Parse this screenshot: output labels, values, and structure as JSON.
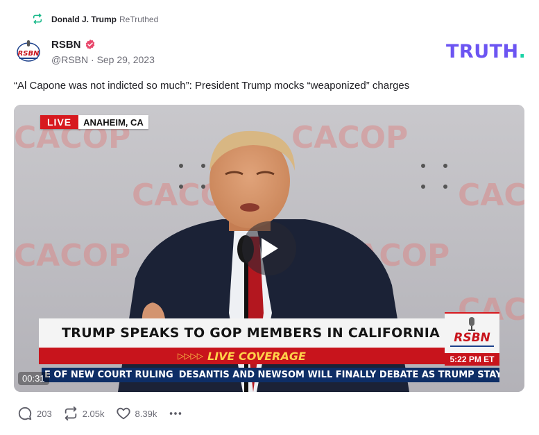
{
  "retruth": {
    "user": "Donald J. Trump",
    "label": "ReTruthed"
  },
  "account": {
    "name": "RSBN",
    "handle": "@RSBN",
    "separator": " · ",
    "date": "Sep 29, 2023",
    "avatar_text": "RSBN"
  },
  "logo": {
    "text": "TRUTH",
    "dot": "."
  },
  "post": {
    "text": "“Al Capone was not indicted so much”: President Trump mocks “weaponized” charges"
  },
  "video": {
    "live_label": "LIVE",
    "location": "ANAHEIM, CA",
    "headline": "TRUMP SPEAKS TO GOP MEMBERS IN CALIFORNIA",
    "coverage_arrows": "▷▷▷▷",
    "coverage": "LIVE COVERAGE",
    "network": "RSBN",
    "clock": "5:22 PM ET",
    "ticker_left": "E OF NEW COURT RULING",
    "ticker_right": "DESANTIS AND NEWSOM WILL FINALLY DEBATE AS TRUMP STAYS ON",
    "duration": "00:31",
    "backdrop_text": "CACOP"
  },
  "stats": {
    "replies": "203",
    "retruths": "2.05k",
    "likes": "8.39k"
  },
  "colors": {
    "accent": "#6c55f2",
    "logo_dot": "#19d3a6",
    "verified": "#e8476b",
    "live_red": "#d7191f",
    "ticker_blue": "#0e2e66",
    "muted": "#6b6b75"
  },
  "icons": {
    "retruth": "retruth-icon",
    "verified": "verified-badge-icon",
    "play": "play-icon",
    "reply": "reply-icon",
    "retruth_action": "retruth-icon",
    "like": "heart-icon",
    "more": "more-icon"
  }
}
